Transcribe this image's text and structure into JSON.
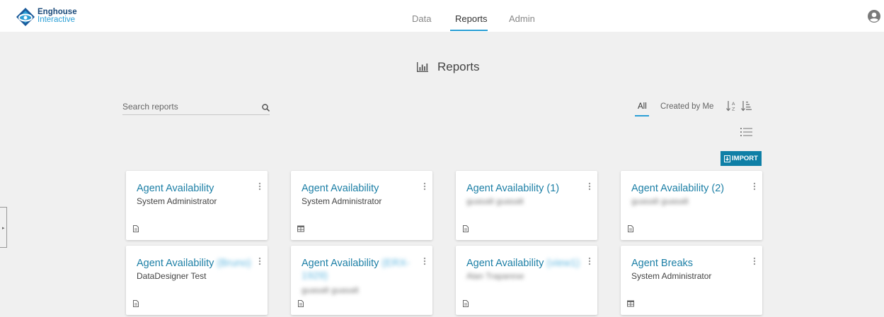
{
  "brand": {
    "line1": "Enghouse",
    "line2": "Interactive"
  },
  "nav": {
    "items": [
      {
        "label": "Data",
        "active": false
      },
      {
        "label": "Reports",
        "active": true
      },
      {
        "label": "Admin",
        "active": false
      }
    ]
  },
  "page": {
    "title": "Reports"
  },
  "search": {
    "placeholder": "Search reports",
    "value": ""
  },
  "filters": {
    "all_label": "All",
    "created_by_me_label": "Created by Me",
    "active": "All"
  },
  "import_label": "IMPORT",
  "colors": {
    "accent": "#2a9fd6",
    "link": "#1c7fa6",
    "import_bg": "#0e7fa6",
    "brand_dark": "#1a4a7a"
  },
  "icons": {
    "search": "search-icon",
    "sort_alpha": "sort-alpha-icon",
    "sort_amount": "sort-amount-icon",
    "list_view": "list-view-icon",
    "import": "import-icon",
    "report_type_document": "document-icon",
    "report_type_table": "table-icon",
    "card_menu": "more-vertical-icon",
    "profile": "user-circle-icon",
    "chart": "bar-chart-icon"
  },
  "reports": [
    {
      "title": "Agent Availability",
      "title_suffix": "",
      "owner": "System Administrator",
      "owner_blurred": false,
      "type": "document"
    },
    {
      "title": "Agent Availability",
      "title_suffix": "",
      "owner": "System Administrator",
      "owner_blurred": false,
      "type": "table"
    },
    {
      "title": "Agent Availability (1)",
      "title_suffix": "",
      "owner": "guasalt guasalt",
      "owner_blurred": true,
      "type": "document"
    },
    {
      "title": "Agent Availability (2)",
      "title_suffix": "",
      "owner": "guasalt guasalt",
      "owner_blurred": true,
      "type": "document"
    },
    {
      "title": "Agent Availability",
      "title_suffix": "(Bruno)",
      "owner": "DataDesigner Test",
      "owner_blurred": false,
      "type": "document"
    },
    {
      "title": "Agent Availability",
      "title_suffix": "(ERX-1929)",
      "owner": "guasalt guasalt",
      "owner_blurred": true,
      "type": "document"
    },
    {
      "title": "Agent Availability",
      "title_suffix": "(view1)",
      "owner": "Alan Traparese",
      "owner_blurred": true,
      "type": "document"
    },
    {
      "title": "Agent Breaks",
      "title_suffix": "",
      "owner": "System Administrator",
      "owner_blurred": false,
      "type": "table"
    }
  ]
}
